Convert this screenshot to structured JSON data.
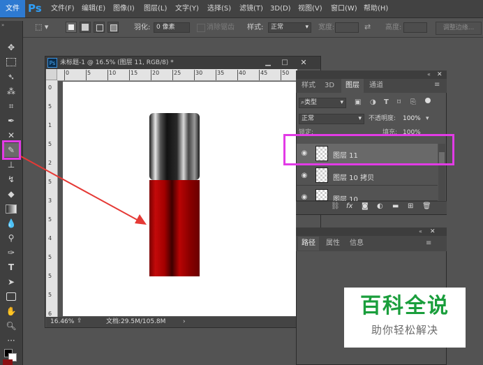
{
  "menubar": {
    "file_tab": "文件",
    "logo": "Ps",
    "items": [
      "文件(F)",
      "编辑(E)",
      "图像(I)",
      "图层(L)",
      "文字(Y)",
      "选择(S)",
      "滤镜(T)",
      "3D(D)",
      "视图(V)",
      "窗口(W)",
      "帮助(H)"
    ]
  },
  "options_bar": {
    "feather_label": "羽化:",
    "feather_value": "0 像素",
    "antialias_label": "消除锯齿",
    "style_label": "样式:",
    "style_value": "正常",
    "width_label": "宽度:",
    "height_label": "高度:",
    "refine_edge_label": "调整边缘..."
  },
  "document": {
    "title": "未标题-1 @ 16.5% (图层 11, RGB/8) *",
    "ruler_top_ticks": [
      "0",
      "5",
      "10",
      "15",
      "20",
      "25",
      "30",
      "35",
      "40",
      "45",
      "50"
    ],
    "ruler_left_ticks": [
      "0",
      "1",
      "2",
      "3",
      "4",
      "5",
      "6"
    ],
    "ruler_left_halfticks": [
      "5",
      "5",
      "5",
      "5",
      "5",
      "5"
    ],
    "zoom": "16.46%",
    "doc_size": "文档:29.5M/105.8M"
  },
  "layers_panel": {
    "tabs": [
      "样式",
      "3D",
      "图层",
      "通道"
    ],
    "active_tab": "图层",
    "filter_kind": "类型",
    "blend_mode": "正常",
    "opacity_label": "不透明度:",
    "opacity_value": "100%",
    "lock_label": "锁定:",
    "fill_label": "填充:",
    "fill_value": "100%",
    "layers": [
      {
        "name": "图层 11",
        "selected": true
      },
      {
        "name": "图层 10 拷贝",
        "selected": false
      },
      {
        "name": "图层 10",
        "selected": false
      }
    ]
  },
  "paths_panel": {
    "tabs": [
      "路径",
      "属性",
      "信息"
    ],
    "active_tab": "路径"
  },
  "watermark": {
    "title": "百科全说",
    "subtitle": "助你轻松解决",
    "title_color": "#1a9e3c"
  },
  "colors": {
    "highlight": "#e23be6",
    "arrow": "#e53935",
    "accent_blue": "#2e7ad1"
  }
}
